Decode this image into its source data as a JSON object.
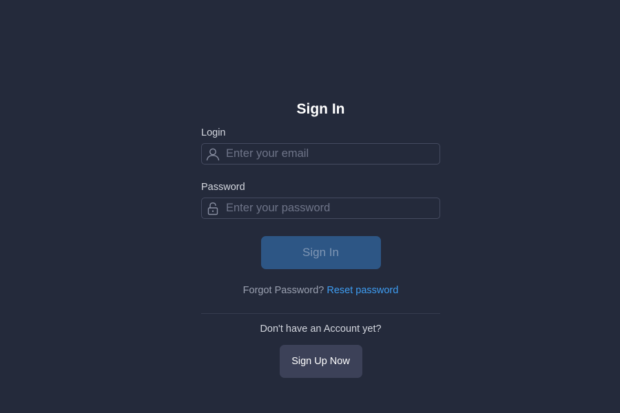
{
  "form": {
    "title": "Sign In",
    "login": {
      "label": "Login",
      "placeholder": "Enter your email",
      "value": "",
      "icon": "user-icon"
    },
    "password": {
      "label": "Password",
      "placeholder": "Enter your password",
      "value": "",
      "icon": "lock-icon"
    },
    "submit_label": "Sign In",
    "forgot_text": "Forgot Password?",
    "reset_link": "Reset password",
    "no_account_text": "Don't have an Account yet?",
    "signup_label": "Sign Up Now"
  },
  "colors": {
    "background": "#242a3b",
    "primary_button": "#2d5685",
    "link": "#3e9df2",
    "secondary_button": "#3c4158"
  }
}
